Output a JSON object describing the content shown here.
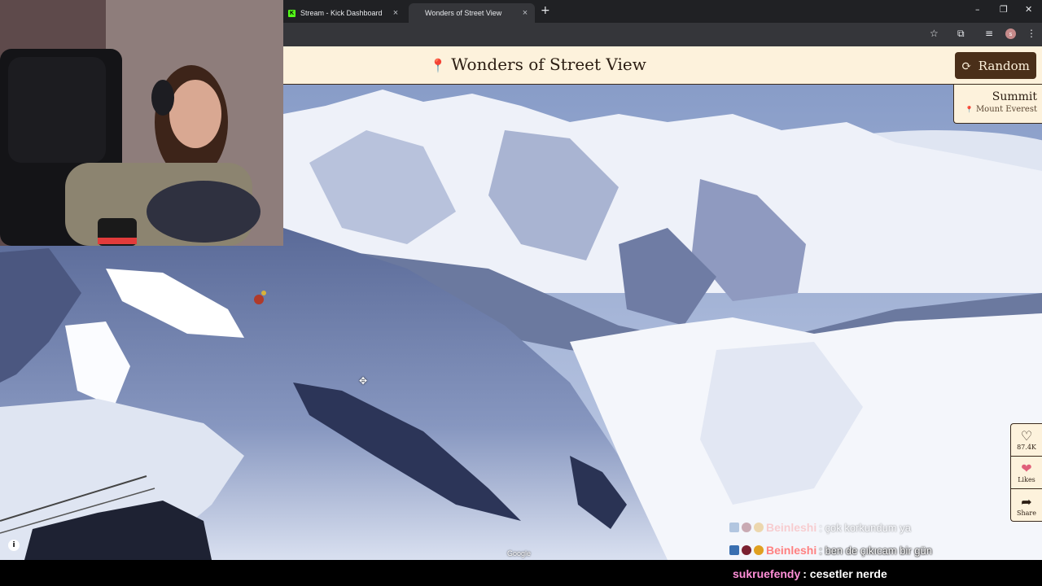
{
  "browser": {
    "tabs": [
      {
        "label": "Stream - Kick Dashboard",
        "favicon": "K",
        "active": false
      },
      {
        "label": "Wonders of Street View",
        "active": true
      }
    ],
    "window_controls": {
      "minimize": "–",
      "restore": "❐",
      "close": "✕"
    },
    "new_tab": "+",
    "profile_initial": "s"
  },
  "site": {
    "title": "Wonders of Street View",
    "title_icon": "map-pin-icon",
    "random_label": "Random",
    "location_name": "Summit",
    "location_sub": "Mount Everest",
    "colors": {
      "header_bg": "#fdf2dc",
      "accent": "#4a2f19"
    }
  },
  "side_buttons": [
    {
      "icon": "heart-outline-icon",
      "label": "87.4K"
    },
    {
      "icon": "hearts-icon",
      "label": "Likes"
    },
    {
      "icon": "share-icon",
      "label": "Share"
    }
  ],
  "map": {
    "attribution": "Google",
    "info": "i"
  },
  "chat": [
    {
      "user": "Beinleshi",
      "message": ": çok korkundum ya",
      "faded": true
    },
    {
      "user": "Beinleshi",
      "message": ": ben de çıkıcam bir gün",
      "faded": false
    },
    {
      "user": "sukruefendy",
      "message": ": cesetler nerde",
      "faded": false
    }
  ]
}
